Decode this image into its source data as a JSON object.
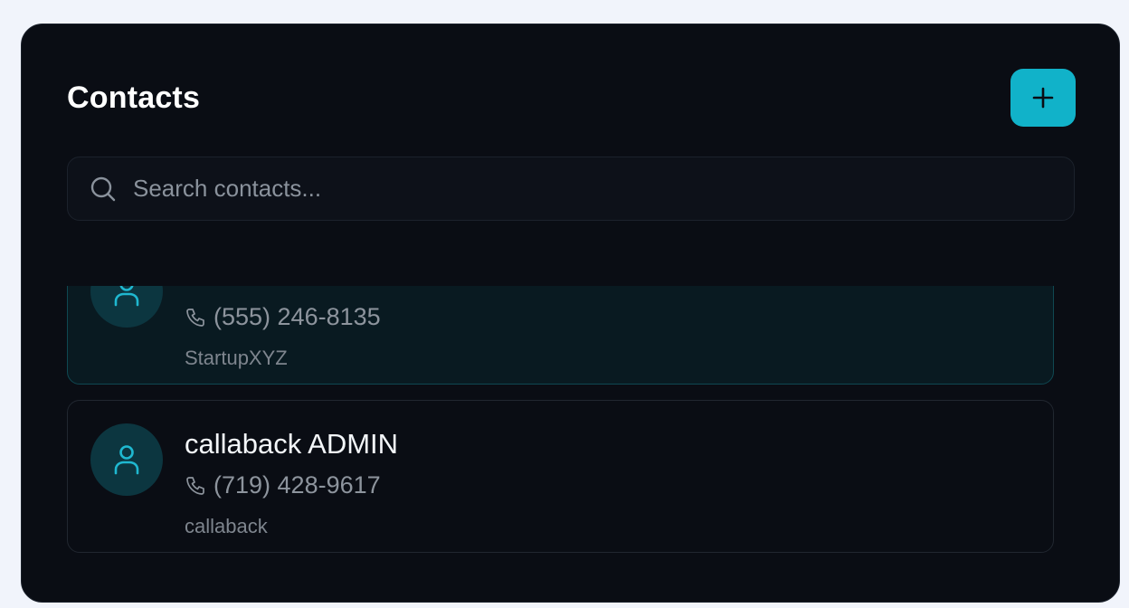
{
  "header": {
    "title": "Contacts",
    "add_button_icon": "plus-icon"
  },
  "search": {
    "placeholder": "Search contacts...",
    "value": "",
    "icon": "search-icon"
  },
  "contacts": [
    {
      "name": "",
      "phone": "(555) 246-8135",
      "company": "StartupXYZ",
      "selected": true
    },
    {
      "name": "callaback ADMIN",
      "phone": "(719) 428-9617",
      "company": "callaback",
      "selected": false
    }
  ],
  "colors": {
    "accent": "#11b2c9",
    "panel_bg": "#0a0d14",
    "selected_bg": "#091a21",
    "avatar_bg": "#0c3640"
  }
}
